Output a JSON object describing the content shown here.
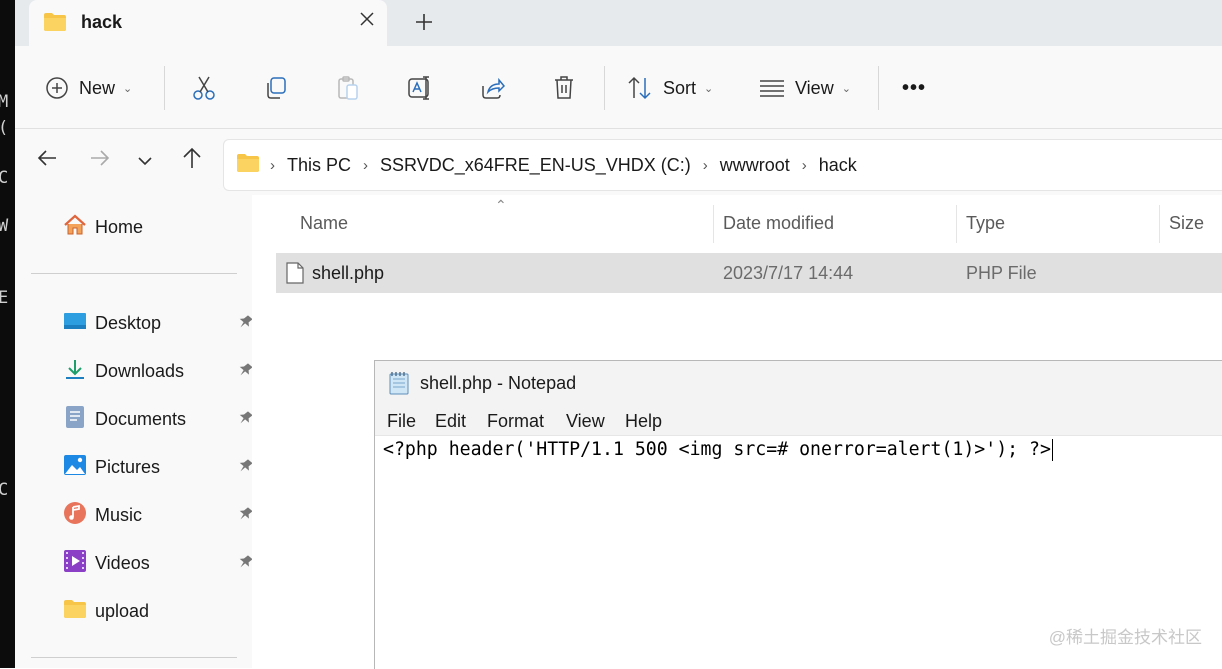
{
  "background_terminal": {
    "chars": [
      "M",
      "(",
      "C",
      "W",
      "E",
      "C"
    ]
  },
  "explorer": {
    "tab": {
      "title": "hack",
      "close_icon": "close-icon",
      "new_tab_icon": "plus-icon"
    },
    "toolbar": {
      "new_label": "New",
      "sort_label": "Sort",
      "view_label": "View",
      "more_label": "•••"
    },
    "breadcrumb": [
      "This PC",
      "SSRVDC_x64FRE_EN-US_VHDX (C:)",
      "wwwroot",
      "hack"
    ],
    "sidebar": {
      "home": "Home",
      "items": [
        {
          "label": "Desktop",
          "pinned": true
        },
        {
          "label": "Downloads",
          "pinned": true
        },
        {
          "label": "Documents",
          "pinned": true
        },
        {
          "label": "Pictures",
          "pinned": true
        },
        {
          "label": "Music",
          "pinned": true
        },
        {
          "label": "Videos",
          "pinned": true
        },
        {
          "label": "upload",
          "pinned": false
        }
      ]
    },
    "columns": [
      "Name",
      "Date modified",
      "Type",
      "Size"
    ],
    "files": [
      {
        "name": "shell.php",
        "date": "2023/7/17 14:44",
        "type": "PHP File",
        "size": ""
      }
    ]
  },
  "notepad": {
    "title": "shell.php - Notepad",
    "menu": [
      "File",
      "Edit",
      "Format",
      "View",
      "Help"
    ],
    "content": "<?php header('HTTP/1.1 500 <img src=# onerror=alert(1)>'); ?>"
  },
  "watermark": "@稀土掘金技术社区",
  "colors": {
    "selected_row": "#e0e0e0",
    "folder": "#f7c548",
    "accent": "#0067c0"
  }
}
